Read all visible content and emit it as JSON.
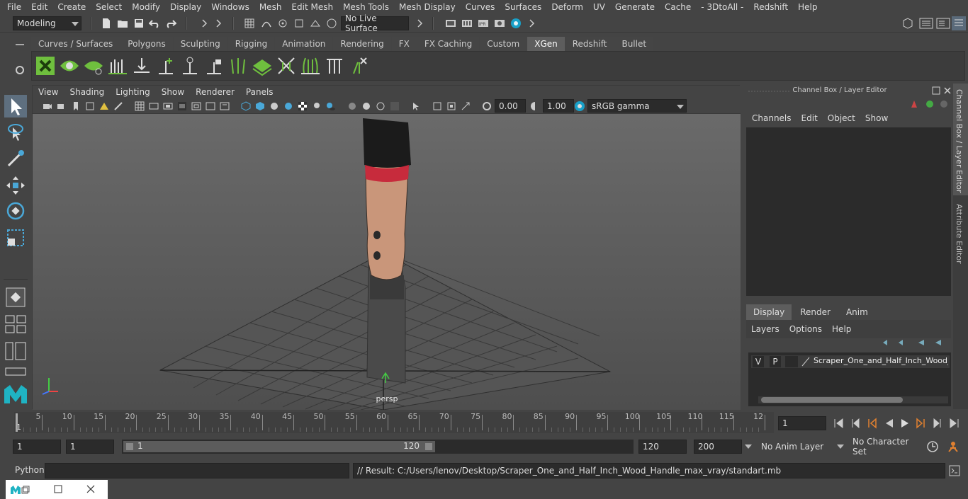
{
  "menubar": [
    "File",
    "Edit",
    "Create",
    "Select",
    "Modify",
    "Display",
    "Windows",
    "Mesh",
    "Edit Mesh",
    "Mesh Tools",
    "Mesh Display",
    "Curves",
    "Surfaces",
    "Deform",
    "UV",
    "Generate",
    "Cache",
    "- 3DtoAll -",
    "Redshift",
    "Help"
  ],
  "status": {
    "mode": "Modeling",
    "live_surface": "No Live Surface"
  },
  "shelf_tabs": [
    "Curves / Surfaces",
    "Polygons",
    "Sculpting",
    "Rigging",
    "Animation",
    "Rendering",
    "FX",
    "FX Caching",
    "Custom",
    "XGen",
    "Redshift",
    "Bullet"
  ],
  "shelf_active": "XGen",
  "viewport": {
    "menus": [
      "View",
      "Shading",
      "Lighting",
      "Show",
      "Renderer",
      "Panels"
    ],
    "exposure": "0.00",
    "gamma": "1.00",
    "color_space": "sRGB gamma",
    "camera_label": "persp"
  },
  "channel_box": {
    "title": "Channel Box / Layer Editor",
    "menus": [
      "Channels",
      "Edit",
      "Object",
      "Show"
    ]
  },
  "layer_editor": {
    "tabs": [
      "Display",
      "Render",
      "Anim"
    ],
    "active_tab": "Display",
    "menus": [
      "Layers",
      "Options",
      "Help"
    ],
    "layer": {
      "v": "V",
      "p": "P",
      "name": "Scraper_One_and_Half_Inch_Wood_H"
    }
  },
  "side_tabs": [
    "Channel Box / Layer Editor",
    "Attribute Editor"
  ],
  "timeline": {
    "ticks": [
      "5",
      "10",
      "15",
      "20",
      "25",
      "30",
      "35",
      "40",
      "45",
      "50",
      "55",
      "60",
      "65",
      "70",
      "75",
      "80",
      "85",
      "90",
      "95",
      "100",
      "105",
      "110",
      "115",
      "12"
    ],
    "start_marker": "1",
    "current_frame": "1"
  },
  "range": {
    "start": "1",
    "playback_start": "1",
    "slider_start": "1",
    "slider_end": "120",
    "playback_end": "120",
    "end": "200",
    "anim_layer": "No Anim Layer",
    "character_set": "No Character Set"
  },
  "command": {
    "language": "Python",
    "result": "// Result: C:/Users/lenov/Desktop/Scraper_One_and_Half_Inch_Wood_Handle_max_vray/standart.mb"
  }
}
